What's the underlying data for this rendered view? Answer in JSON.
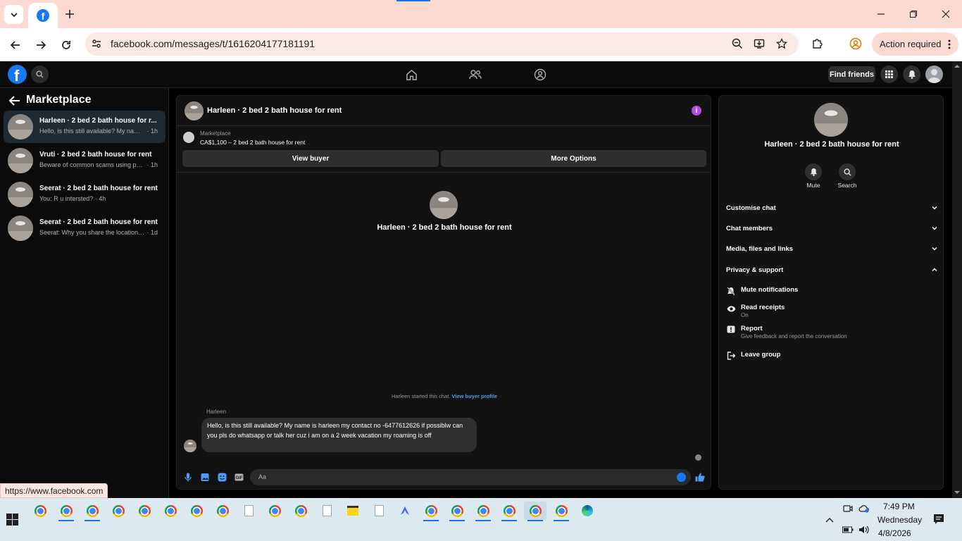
{
  "browser": {
    "url": "facebook.com/messages/t/1616204177181191",
    "action_required": "Action required",
    "status_url": "https://www.facebook.com"
  },
  "fb": {
    "find_friends": "Find friends"
  },
  "sidebar": {
    "title": "Marketplace",
    "conversations": [
      {
        "name": "Harleen · 2 bed 2 bath house for r...",
        "preview": "Hello, is this still available? My name i...",
        "time": "· 1h",
        "active": true
      },
      {
        "name": "Vruti · 2 bed 2 bath house for rent",
        "preview": "Beware of common scams using pay...",
        "time": "· 1h",
        "active": false
      },
      {
        "name": "Seerat · 2 bed 2 bath house for rent",
        "preview": "You: R u intersted?",
        "time": "· 4h",
        "active": false
      },
      {
        "name": "Seerat · 2 bed 2 bath house for rent",
        "preview": "Seerat: Why you share the location of ...",
        "time": "· 1d",
        "active": false
      }
    ]
  },
  "chat": {
    "header_name": "Harleen · 2 bed 2 bath house for rent",
    "marketplace_label": "Marketplace",
    "listing": "CA$1,100 – 2 bed 2 bath house for rent",
    "view_buyer": "View buyer",
    "more_options": "More Options",
    "center_name": "Harleen · 2 bed 2 bath house for rent",
    "started_text": "Harleen started this chat.",
    "view_buyer_profile": "View buyer profile",
    "sender": "Harleen",
    "message": "Hello, is this still available? My name is harleen my contact no -6477612626 if possiblw can you pls do whatsapp or talk her cuz i am on a 2 week vacation my roaming is off",
    "composer_placeholder": "Aa"
  },
  "info": {
    "name": "Harleen · 2 bed 2 bath house for rent",
    "mute": "Mute",
    "search": "Search",
    "sections": [
      "Customise chat",
      "Chat members",
      "Media, files and links",
      "Privacy & support"
    ],
    "options": [
      {
        "label": "Mute notifications",
        "sub": "",
        "icon": "bell-off-icon"
      },
      {
        "label": "Read receipts",
        "sub": "On",
        "icon": "eye-icon"
      },
      {
        "label": "Report",
        "sub": "Give feedback and report the conversation",
        "icon": "report-icon"
      },
      {
        "label": "Leave group",
        "sub": "",
        "icon": "leave-icon"
      }
    ]
  },
  "taskbar": {
    "time": "7:49 PM",
    "day": "Wednesday",
    "date": "4/8/2026"
  }
}
